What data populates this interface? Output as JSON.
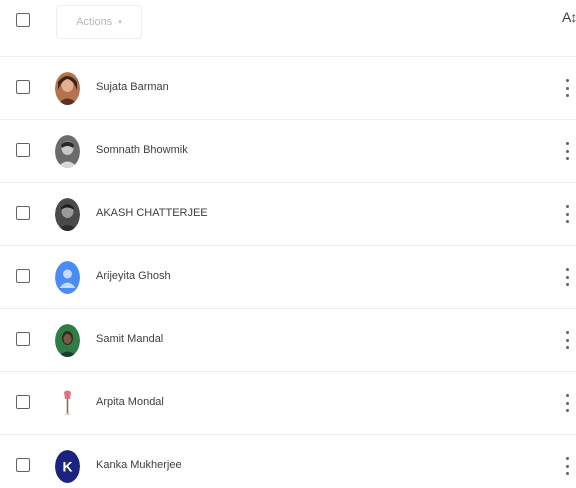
{
  "toolbar": {
    "actions_label": "Actions",
    "actions_caret": "▾",
    "sort_icon": "sort-az-icon",
    "sort_glyph": "A↕"
  },
  "colors": {
    "checkbox_border": "#5f6368",
    "row_divider": "#ececec",
    "text": "#3c4043"
  },
  "users": [
    {
      "name": "Sujata Barman",
      "avatar": "photo-avatar"
    },
    {
      "name": "Somnath Bhowmik",
      "avatar": "photo-avatar"
    },
    {
      "name": "AKASH CHATTERJEE",
      "avatar": "photo-avatar"
    },
    {
      "name": "Arijeyita Ghosh",
      "avatar": "default-user-avatar"
    },
    {
      "name": "Samit Mandal",
      "avatar": "photo-avatar"
    },
    {
      "name": "Arpita Mondal",
      "avatar": "photo-avatar"
    },
    {
      "name": "Kanka Mukherjee",
      "avatar": "initial-avatar",
      "initial": "K"
    }
  ]
}
